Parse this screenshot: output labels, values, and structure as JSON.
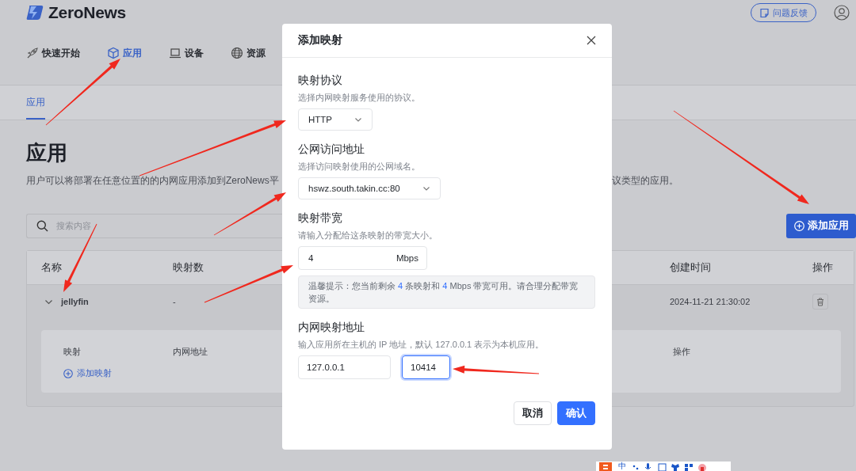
{
  "header": {
    "logo": "ZeroNews",
    "feedback": "问题反馈"
  },
  "nav": [
    {
      "label": "快速开始",
      "selected": false
    },
    {
      "label": "应用",
      "selected": true
    },
    {
      "label": "设备",
      "selected": false
    },
    {
      "label": "资源",
      "selected": false
    }
  ],
  "subtabs": [
    {
      "label": "应用",
      "selected": true
    }
  ],
  "page": {
    "title": "应用",
    "description_left": "用户可以将部署在任意位置的的内网应用添加到ZeroNews平",
    "description_right": "议类型的应用。",
    "search": {
      "placeholder": "搜索内容"
    },
    "add_button": "添加应用"
  },
  "table": {
    "columns": [
      "名称",
      "映射数",
      "创建时间",
      "操作"
    ],
    "rows": [
      {
        "name": "jellyfin",
        "mappings": "-",
        "created": "2024-11-21 21:30:02",
        "expanded": true,
        "detail": {
          "columns": [
            "映射",
            "内网地址",
            "操作"
          ],
          "add_link": "添加映射"
        }
      }
    ]
  },
  "dialog": {
    "title": "添加映射",
    "sections": [
      {
        "kind": "select",
        "label": "映射协议",
        "hint": "选择内网映射服务使用的协议。",
        "value": "HTTP"
      },
      {
        "kind": "select",
        "label": "公网访问地址",
        "hint": "选择访问映射使用的公网域名。",
        "value": "hswz.south.takin.cc:80"
      },
      {
        "kind": "unit-input",
        "label": "映射带宽",
        "hint": "请输入分配给这条映射的带宽大小。",
        "value": "4",
        "unit": "Mbps",
        "tip": [
          {
            "text": "温馨提示：您当前剩余 ",
            "highlight": false
          },
          {
            "text": "4",
            "highlight": true
          },
          {
            "text": "  条映射和  ",
            "highlight": false
          },
          {
            "text": "4",
            "highlight": true
          },
          {
            "text": " Mbps 带宽可用。请合理分配带宽资源。",
            "highlight": false
          }
        ]
      },
      {
        "kind": "address",
        "label": "内网映射地址",
        "hint": "输入应用所在主机的 IP 地址，默认 127.0.0.1 表示为本机应用。",
        "fields": [
          {
            "value": "127.0.0.1",
            "focused": false
          },
          {
            "value": "10414",
            "focused": true
          }
        ]
      }
    ],
    "buttons": [
      {
        "label": "取消",
        "primary": false
      },
      {
        "label": "确认",
        "primary": true
      }
    ]
  },
  "ime_toolbar": {
    "label": "中"
  }
}
